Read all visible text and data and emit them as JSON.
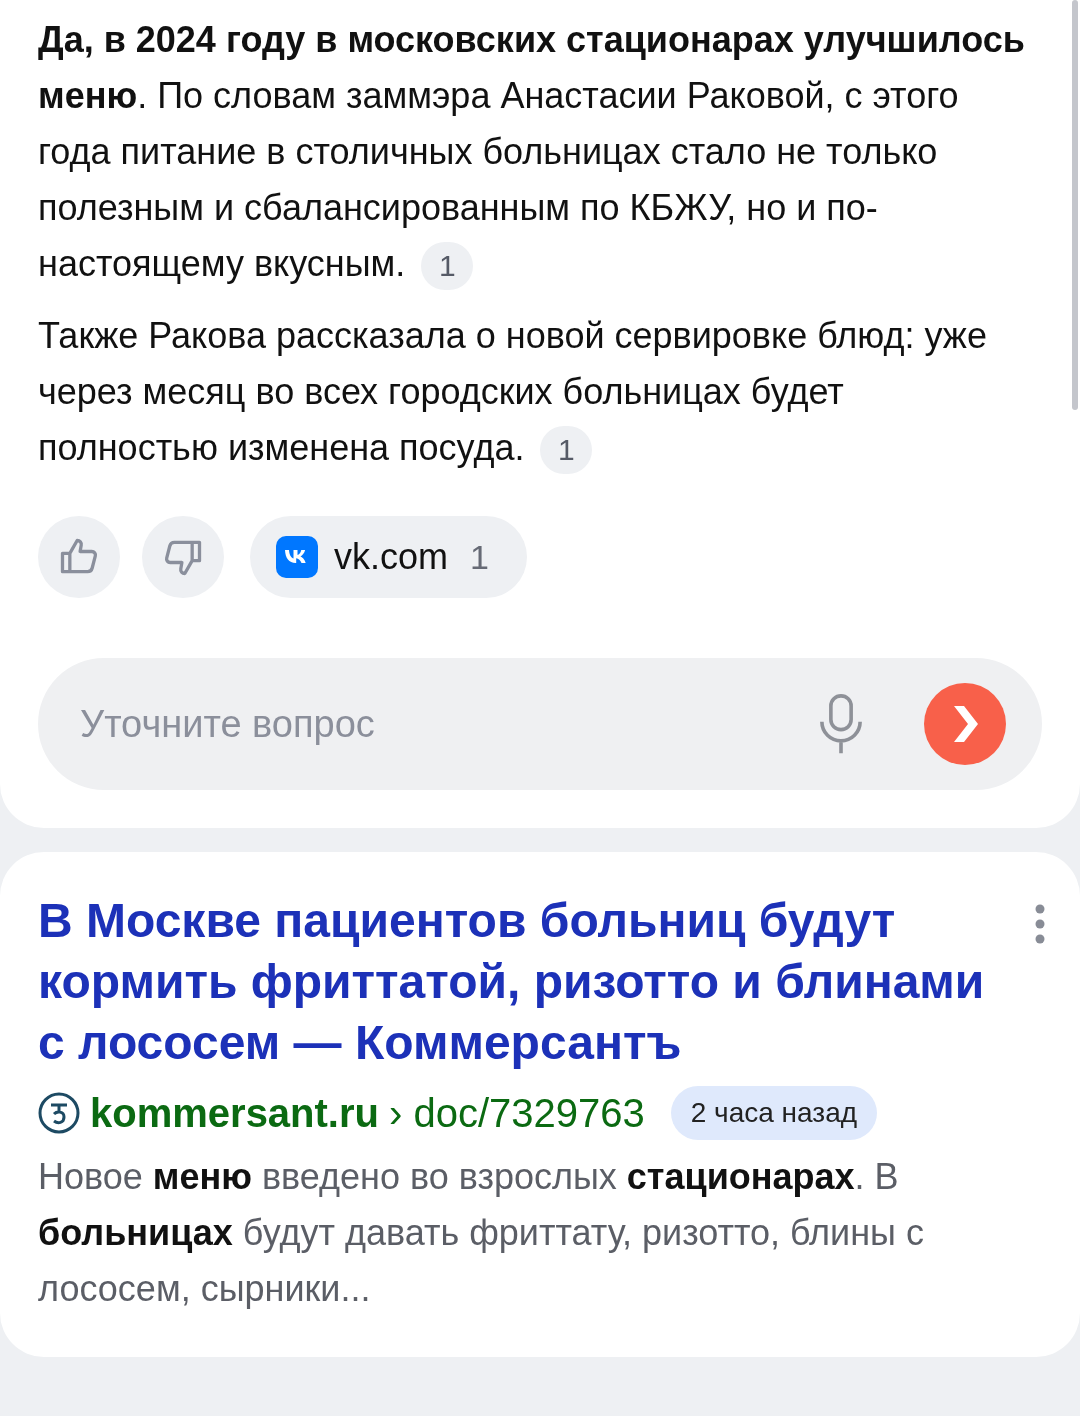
{
  "answer": {
    "paragraphs": [
      {
        "text": "**Да, в 2024 году в московских стационарах улучшилось меню**. По словам заммэра Анастасии Раковой, с этого года питание в столичных больницах стало не только полезным и сбалансированным по КБЖУ, но и по-настоящему вкусным.",
        "citation": "1"
      },
      {
        "text": "Также Ракова рассказала о новой сервировке блюд: уже через месяц во всех городских больницах будет полностью изменена посуда.",
        "citation": "1"
      }
    ]
  },
  "feedback": [
    {
      "kind": "like"
    },
    {
      "kind": "dislike"
    }
  ],
  "source_chip": {
    "domain": "vk.com",
    "count": "1"
  },
  "query_field": {
    "placeholder": "Уточните вопрос"
  },
  "result": {
    "title": "В Москве пациентов больниц будут кормить фриттатой, ризотто и блинами с лососем — Коммерсантъ",
    "site": "kommersant.ru",
    "path": "› doc/7329763",
    "time": "2 часа назад",
    "snippet": "Новое **меню** введено во взрослых **стационарах**. В **больницах** будут давать фриттату, ризотто, блины с лососем, сырники..."
  }
}
